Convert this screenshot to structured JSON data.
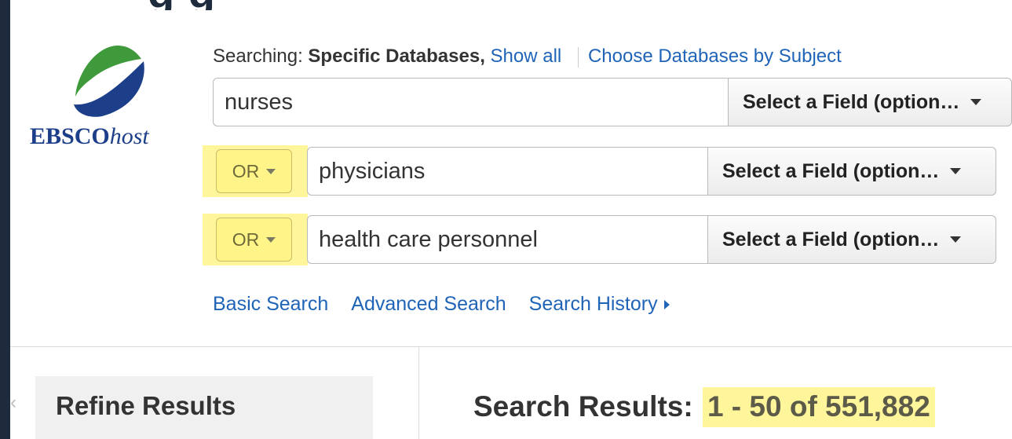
{
  "heading_fragment": "g    g",
  "logo": {
    "brand_bold": "EBSCO",
    "brand_italic": "host",
    "colors": {
      "green": "#3e9a3a",
      "blue": "#1d3f8a"
    }
  },
  "searching": {
    "label": "Searching:",
    "databases": "Specific Databases,",
    "show_all": "Show all",
    "choose_by_subject": "Choose Databases by Subject"
  },
  "search_rows": [
    {
      "operator": "",
      "query": "nurses",
      "field": "Select a Field (option…"
    },
    {
      "operator": "OR",
      "query": "physicians",
      "field": "Select a Field (option…"
    },
    {
      "operator": "OR",
      "query": "health care personnel",
      "field": "Select a Field (option…"
    }
  ],
  "links": {
    "basic": "Basic Search",
    "advanced": "Advanced Search",
    "history": "Search History"
  },
  "refine": {
    "label": "Refine Results"
  },
  "results": {
    "label": "Search Results:",
    "range": "1 - 50 of 551,882"
  },
  "colors": {
    "link": "#1f64b7",
    "highlight": "#fff59a",
    "frame": "#1d2b3c"
  }
}
